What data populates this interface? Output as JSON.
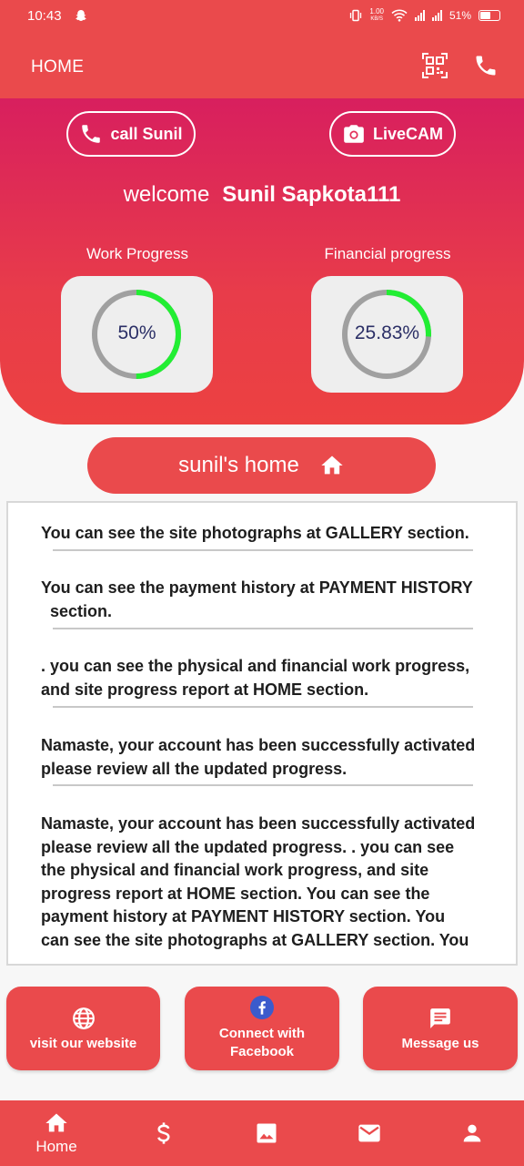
{
  "status_bar": {
    "time": "10:43",
    "speed_value": "1.00",
    "speed_unit": "KB/S",
    "battery": "51%"
  },
  "app_bar": {
    "title": "HOME"
  },
  "hero": {
    "call_button": "call Sunil",
    "livecam_button": "LiveCAM",
    "welcome_word": "welcome",
    "user_name": "Sunil Sapkota111",
    "work_progress": {
      "label": "Work Progress",
      "value_text": "50%",
      "fraction": 0.5
    },
    "financial_progress": {
      "label": "Financial progress",
      "value_text": "25.83%",
      "fraction": 0.2583
    }
  },
  "home_button": "sunil's home",
  "notices": [
    {
      "line1": "You can see the site photographs at GALLERY section."
    },
    {
      "line1": "You can see the payment history at PAYMENT HISTORY",
      "line2": "section."
    },
    {
      "line1": ". you can see the physical and financial work progress,",
      "line2": "and site progress report at HOME section."
    },
    {
      "line1": "Namaste, your account has been successfully activated",
      "line2": "please review all the updated progress."
    },
    {
      "lines": [
        "Namaste, your account has been successfully activated",
        "please review all the updated progress.  . you can see",
        "the physical and financial work progress, and site",
        "progress report at HOME section. You can see the",
        "payment history at PAYMENT HISTORY   section. You",
        "can see the site photographs at GALLERY section. You"
      ]
    }
  ],
  "actions": {
    "website": "visit our website",
    "facebook": "Connect with Facebook",
    "message": "Message us"
  },
  "bottom_nav": {
    "home": "Home"
  },
  "colors": {
    "primary": "#ea4a4c",
    "hero_top": "#d81f5e",
    "gauge_progress": "#22ee33",
    "gauge_track": "#a0a0a0",
    "gauge_text": "#2b2f66",
    "facebook": "#3b5bcc"
  },
  "icons": [
    "snapchat-icon",
    "vibrate-icon",
    "wifi-icon",
    "signal-icon",
    "battery-icon",
    "qr-code-icon",
    "phone-icon",
    "camera-icon",
    "home-icon",
    "globe-icon",
    "facebook-icon",
    "chat-icon",
    "dollar-icon",
    "image-icon",
    "mail-icon",
    "person-icon"
  ]
}
